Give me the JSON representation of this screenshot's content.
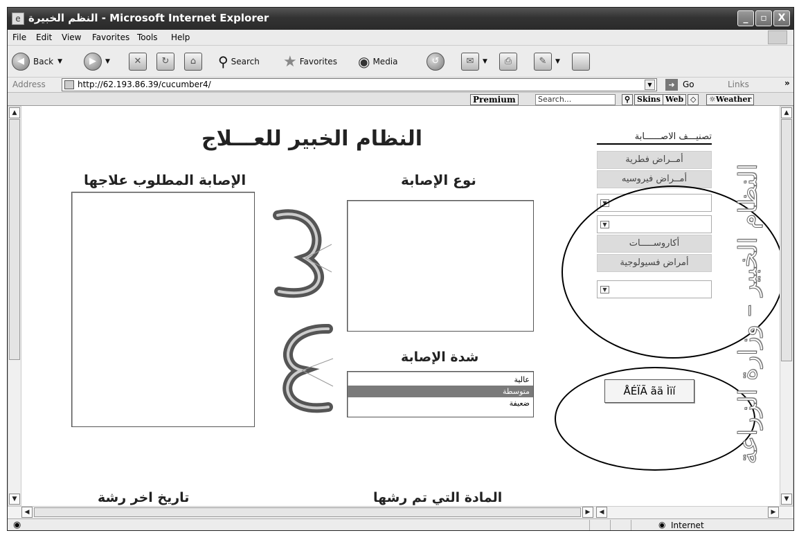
{
  "window": {
    "title": "النظم الخبيرة - Microsoft Internet Explorer",
    "minimize_label": "_",
    "maximize_label": "▫",
    "close_label": "X"
  },
  "menu": [
    "File",
    "Edit",
    "View",
    "Favorites",
    "Tools",
    "Help"
  ],
  "toolbar": {
    "back": "Back",
    "search": "Search",
    "favorites": "Favorites",
    "media": "Media"
  },
  "address": {
    "label": "Address",
    "url": "http://62.193.86.39/cucumber4/",
    "go": "Go",
    "links": "Links"
  },
  "extra_toolbar": {
    "premium": "Premium",
    "search_placeholder": "Search...",
    "skins": "Skins",
    "web": "Web",
    "weather": "Weather"
  },
  "page": {
    "title": "النظام الخبير للعـــلاج",
    "treat_heading": "الإصابة المطلوب علاجها",
    "type_heading": "نوع الإصابة",
    "severity_heading": "شدة الإصابة",
    "severity_options": [
      "عالية",
      "متوسطة",
      "ضعيفة"
    ],
    "severity_selected_index": 1,
    "bottom_left_heading": "تاريخ اخر رشة",
    "bottom_right_heading": "المادة التي تم رشها",
    "category_title": "تصنيـــف الاصــــــابة",
    "categories": {
      "fungal": "أمــراض فطرية",
      "viral": "أمــراض فيروسيه",
      "acari": "أكاروســـــات",
      "physio": "أمراض فسيولوجية"
    },
    "submit_button": "ÅÉÏÃ ãä Ìïí",
    "side_label": "النظام الخبير – وزارة الزراعة"
  },
  "status": {
    "zone": "Internet"
  }
}
